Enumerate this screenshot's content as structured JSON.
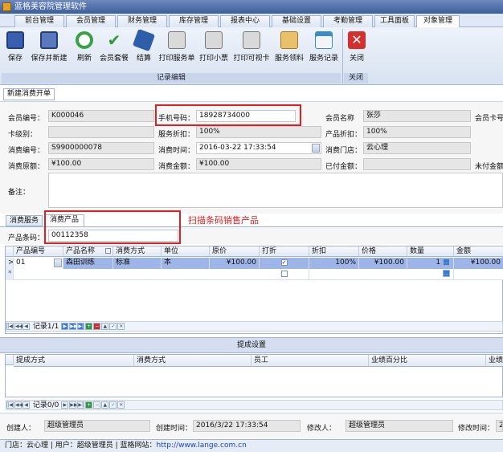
{
  "window": {
    "title": "蓝格美容院管理软件"
  },
  "tabs": [
    "前台管理",
    "会员管理",
    "财务管理",
    "库存管理",
    "报表中心",
    "基础设置",
    "考勤管理",
    "工具面板",
    "对象管理"
  ],
  "toolbar": {
    "buttons": [
      "保存",
      "保存并新建",
      "刷新",
      "会员套餐",
      "结算",
      "打印服务单",
      "打印小票",
      "打印可视卡",
      "服务领料",
      "服务记录"
    ],
    "close_label": "关闭",
    "group_edit": "记录编辑",
    "group_close": "关闭"
  },
  "subtab": "新建消费开单",
  "form": {
    "member_no_label": "会员编号：",
    "member_no": "K000046",
    "phone_label": "手机号码：",
    "phone": "18928734000",
    "member_name_label": "会员名称",
    "member_name": "张莎",
    "member_card_label": "会员卡号",
    "card_level_label": "卡级别：",
    "card_level": "",
    "service_discount_label": "服务折扣：",
    "service_discount": "100%",
    "product_discount_label": "产品折扣：",
    "product_discount": "100%",
    "consume_no_label": "消费编号：",
    "consume_no": "S9900000078",
    "consume_time_label": "消费时间：",
    "consume_time": "2016-03-22 17:33:54",
    "store_label": "消费门店：",
    "store": "云心理",
    "original_amount_label": "消费原额：",
    "original_amount": "¥100.00",
    "amount_label": "消费金额：",
    "amount": "¥100.00",
    "paid_label": "已付金额：",
    "paid": "",
    "unpaid_label": "未付金额",
    "remark_label": "备注：",
    "remark": ""
  },
  "product_tabs": [
    "消费服务",
    "消费产品"
  ],
  "annotation": "扫描条码销售产品",
  "barcode": {
    "label": "产品条码：",
    "value": "00112358"
  },
  "product_grid": {
    "columns": [
      "产品编号",
      "产品名称",
      "消费方式",
      "单位",
      "原价",
      "打折",
      "折扣",
      "价格",
      "数量",
      "金额"
    ],
    "rows": [
      {
        "indicator": ">",
        "code": "01",
        "name": "森田训练",
        "mode": "标准",
        "unit": "本",
        "price": "¥100.00",
        "discount": "100%",
        "final_price": "¥100.00",
        "qty": "1",
        "amount": "¥100.00"
      }
    ],
    "new_row_indicator": "*",
    "nav_record": "记录1/1"
  },
  "commission": {
    "title": "提成设置",
    "columns": [
      "提成方式",
      "消费方式",
      "员工",
      "业绩百分比",
      "业绩"
    ],
    "nav_record": "记录0/0"
  },
  "footer": {
    "creator_label": "创建人：",
    "creator": "超级管理员",
    "created_label": "创建时间：",
    "created": "2016/3/22 17:33:54",
    "modifier_label": "修改人：",
    "modifier": "超级管理员",
    "modified_label": "修改时间：",
    "modified": "2"
  },
  "status": {
    "text": "门店：云心理 | 用户：超级管理员 | 蓝格网站：",
    "link": "http://www.lange.com.cn"
  }
}
